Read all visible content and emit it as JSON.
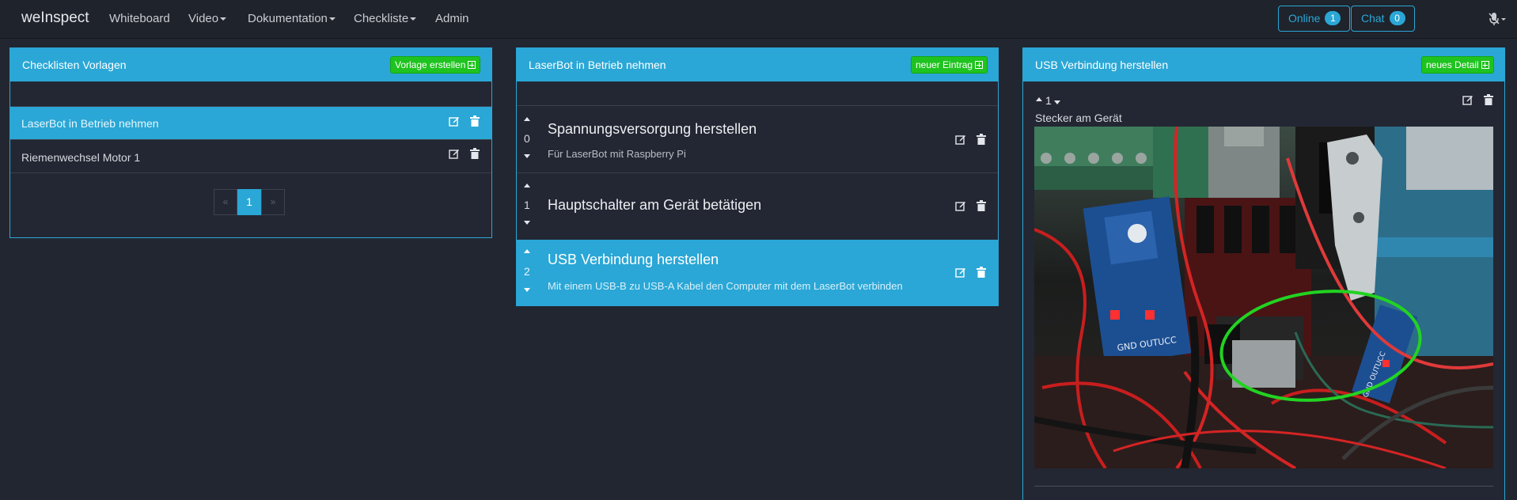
{
  "navbar": {
    "brand": "weInspect",
    "items": [
      {
        "label": "Whiteboard",
        "dropdown": false
      },
      {
        "label": "Video",
        "dropdown": true
      },
      {
        "label": "Dokumentation",
        "dropdown": true
      },
      {
        "label": "Checkliste",
        "dropdown": true
      },
      {
        "label": "Admin",
        "dropdown": false
      }
    ],
    "online_label": "Online",
    "online_count": "1",
    "chat_label": "Chat",
    "chat_count": "0"
  },
  "templates_panel": {
    "title": "Checklisten Vorlagen",
    "create_label": "Vorlage erstellen",
    "items": [
      {
        "label": "LaserBot in Betrieb nehmen",
        "selected": true
      },
      {
        "label": "Riemenwechsel Motor 1",
        "selected": false
      }
    ],
    "pagination": {
      "prev": "«",
      "current": "1",
      "next": "»"
    }
  },
  "entries_panel": {
    "title": "LaserBot in Betrieb nehmen",
    "new_label": "neuer Eintrag",
    "entries": [
      {
        "index": "0",
        "title": "Spannungsversorgung herstellen",
        "subtitle": "Für LaserBot mit Raspberry Pi",
        "selected": false
      },
      {
        "index": "1",
        "title": "Hauptschalter am Gerät betätigen",
        "subtitle": "",
        "selected": false
      },
      {
        "index": "2",
        "title": "USB Verbindung herstellen",
        "subtitle": "Mit einem USB-B zu USB-A Kabel den Computer mit dem LaserBot verbinden",
        "selected": true
      }
    ]
  },
  "details_panel": {
    "title": "USB Verbindung herstellen",
    "new_label": "neues Detail",
    "detail_index": "1",
    "detail_caption": "Stecker am Gerät",
    "image_labels": {
      "left_module": "GND OUTUCC",
      "right_module": "GND OUTUCC"
    }
  },
  "colors": {
    "accent": "#2aa7d6",
    "success": "#1fc31f",
    "background": "#222631",
    "navbar": "#1f232c",
    "highlight_ellipse": "#22d322"
  }
}
